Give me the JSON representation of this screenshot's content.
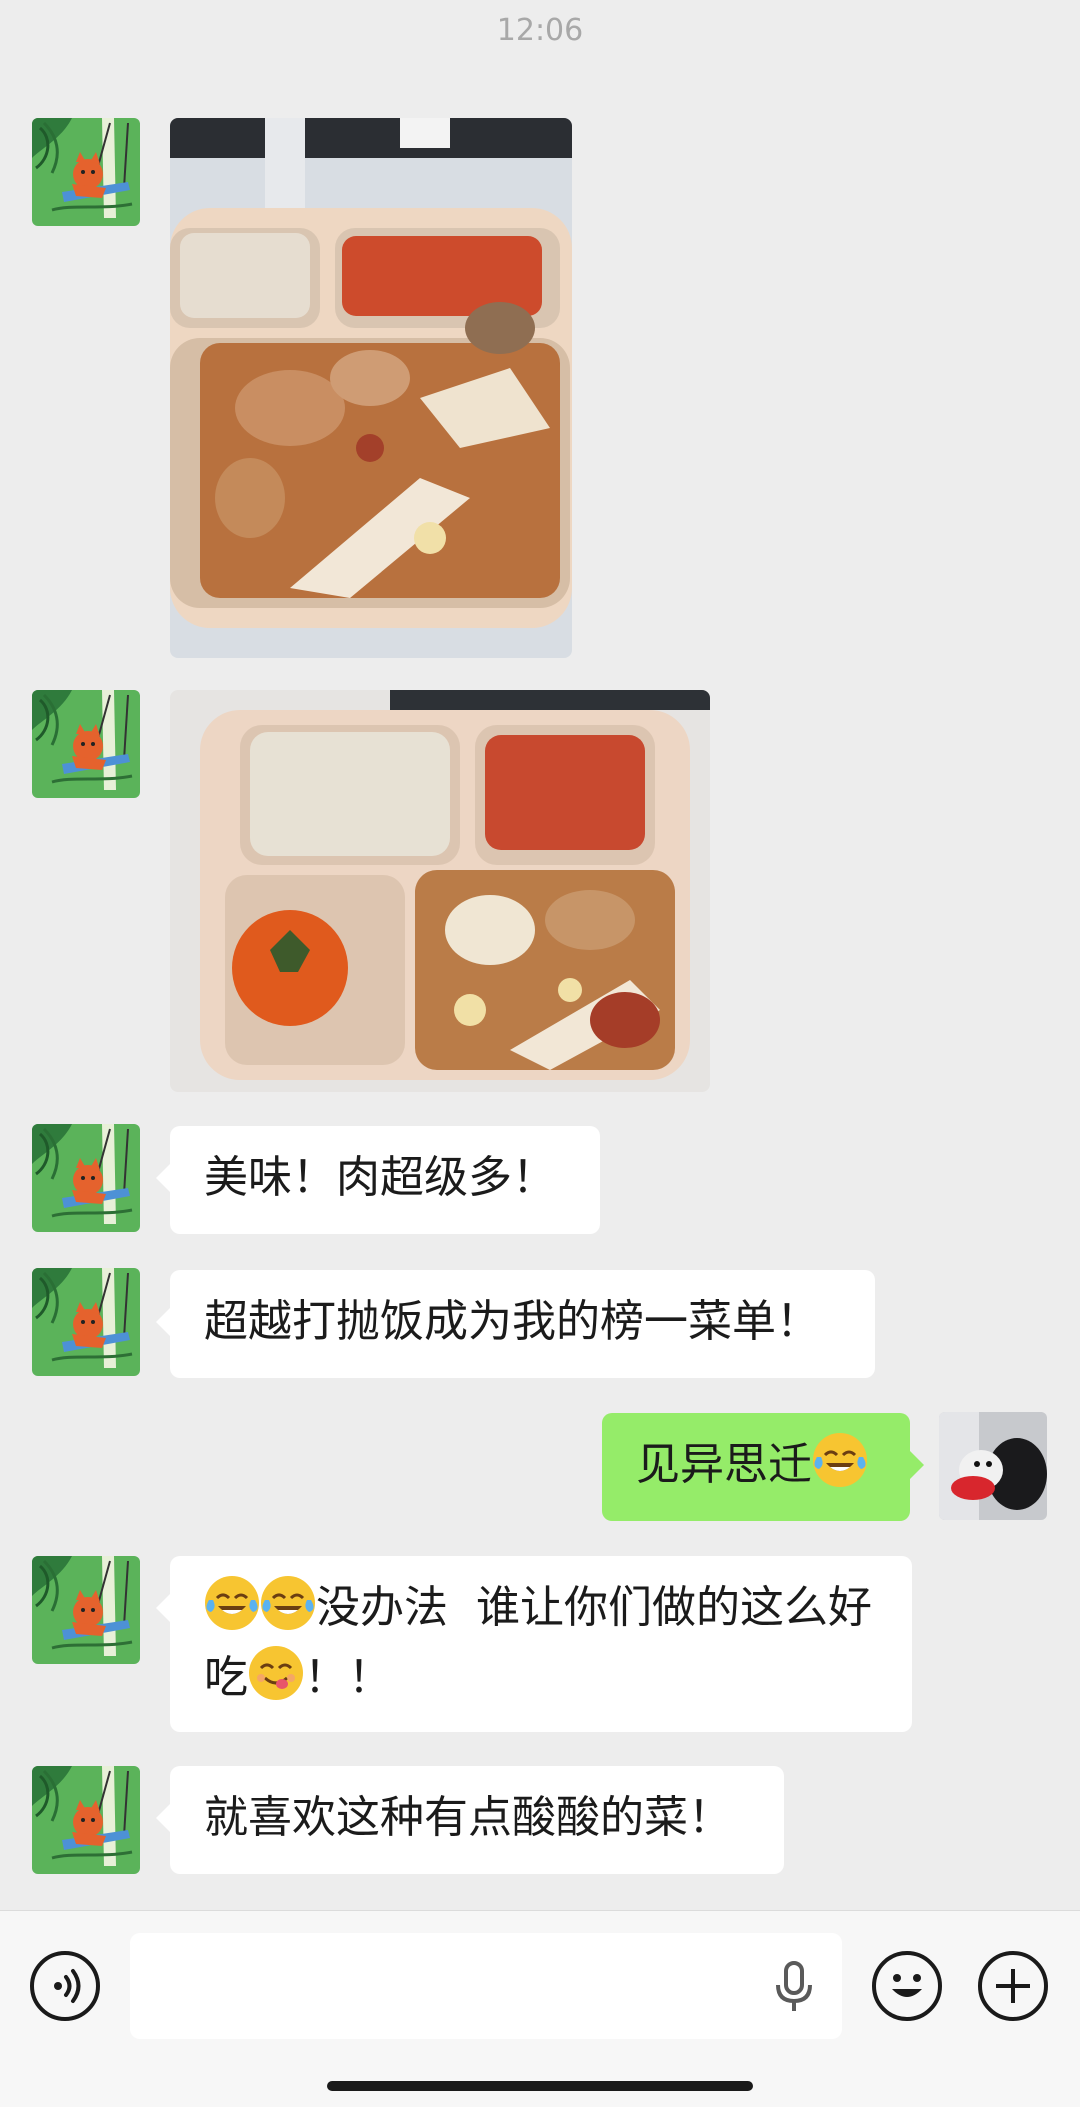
{
  "status_time": "12:06",
  "messages": [
    {
      "type": "image",
      "sender": "friend",
      "content": "food-photo-1"
    },
    {
      "type": "image",
      "sender": "friend",
      "content": "food-photo-2"
    },
    {
      "type": "text",
      "sender": "friend",
      "text": "美味！肉超级多！"
    },
    {
      "type": "text",
      "sender": "friend",
      "text": "超越打抛饭成为我的榜一菜单！"
    },
    {
      "type": "text",
      "sender": "self",
      "text": "见异思迁",
      "emoji": "tears-of-joy"
    },
    {
      "type": "text",
      "sender": "friend",
      "line1_text": "没办法  谁让你们做的这么好",
      "line2_text": "吃",
      "line2_tail": "！！",
      "emoji_lead": [
        "tears-of-joy",
        "tears-of-joy"
      ],
      "emoji_inline": "yum"
    },
    {
      "type": "text",
      "sender": "friend",
      "text": "就喜欢这种有点酸酸的菜！"
    }
  ],
  "input": {
    "value": "",
    "placeholder": ""
  },
  "icons": [
    "voice-toggle-icon",
    "microphone-icon",
    "emoji-icon",
    "plus-icon"
  ],
  "colors": {
    "background": "#ededed",
    "self_bubble": "#95ec69",
    "friend_bubble": "#ffffff"
  }
}
